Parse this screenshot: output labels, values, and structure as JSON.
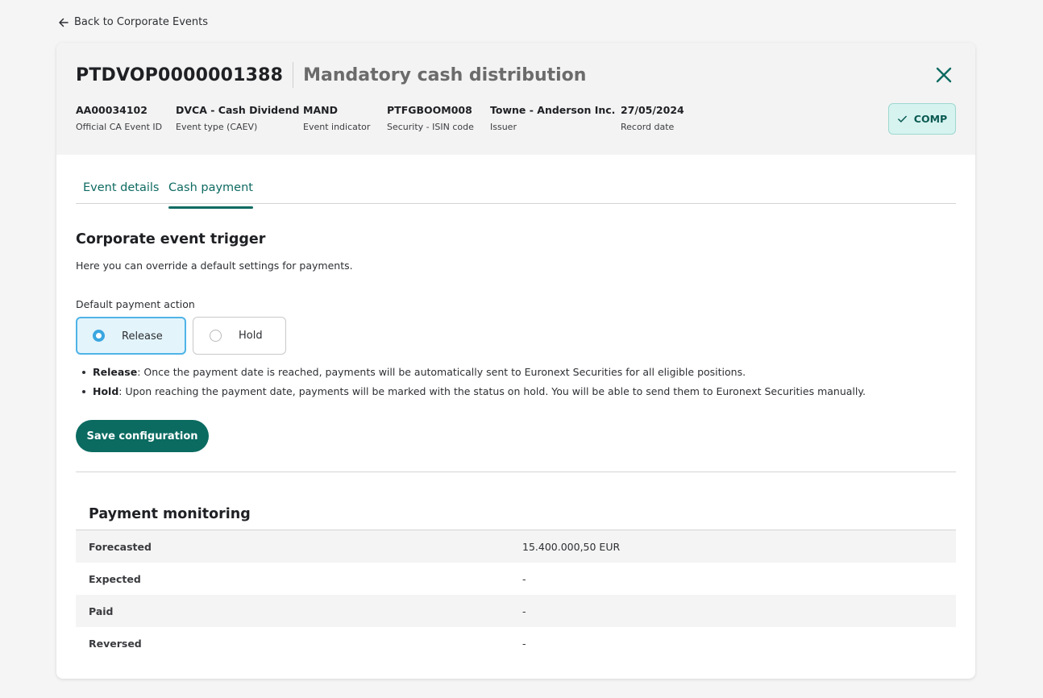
{
  "nav": {
    "back_label": "Back to Corporate Events"
  },
  "header": {
    "event_id": "PTDVOP0000001388",
    "event_name": "Mandatory cash distribution",
    "status": "COMP",
    "meta": [
      {
        "value": "AA00034102",
        "label": "Official CA Event ID"
      },
      {
        "value": "DVCA - Cash Dividend",
        "label": "Event type (CAEV)"
      },
      {
        "value": "MAND",
        "label": "Event indicator"
      },
      {
        "value": "PTFGBOOM008",
        "label": "Security - ISIN code"
      },
      {
        "value": "Towne - Anderson Inc.",
        "label": "Issuer"
      },
      {
        "value": "27/05/2024",
        "label": "Record date"
      }
    ]
  },
  "tabs": [
    {
      "label": "Event details",
      "active": false
    },
    {
      "label": "Cash payment",
      "active": true
    }
  ],
  "trigger": {
    "title": "Corporate event trigger",
    "description": "Here you can override a default settings for payments.",
    "field_label": "Default payment action",
    "options": [
      {
        "label": "Release",
        "selected": true
      },
      {
        "label": "Hold",
        "selected": false
      }
    ],
    "bullets": [
      {
        "term": "Release",
        "text": ": Once the payment date is reached, payments will be automatically sent to Euronext Securities for all eligible positions."
      },
      {
        "term": "Hold",
        "text": ": Upon reaching the payment date, payments will be marked with the status on hold. You will be able to send them to Euronext Securities manually."
      }
    ],
    "save_label": "Save configuration"
  },
  "monitoring": {
    "title": "Payment monitoring",
    "rows": [
      {
        "label": "Forecasted",
        "value": "15.400.000,50 EUR"
      },
      {
        "label": "Expected",
        "value": "-"
      },
      {
        "label": "Paid",
        "value": "-"
      },
      {
        "label": "Reversed",
        "value": "-"
      }
    ]
  },
  "colors": {
    "primary": "#0b6b61",
    "badge_bg": "#d6f3f0",
    "radio_selected": "#3aa6e0"
  },
  "icons": {
    "back": "arrow-left-icon",
    "close": "close-icon",
    "status": "check-icon"
  }
}
